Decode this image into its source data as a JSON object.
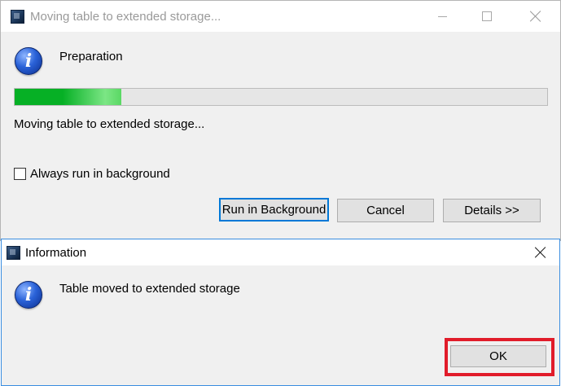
{
  "progress_dialog": {
    "title": "Moving table to extended storage...",
    "heading": "Preparation",
    "progress_fraction": 0.2,
    "status_text": "Moving table to extended storage...",
    "checkbox_label": "Always run in background",
    "checkbox_checked": false,
    "buttons": {
      "run_in_background": "Run in Background",
      "cancel": "Cancel",
      "details": "Details >>"
    }
  },
  "info_dialog": {
    "title": "Information",
    "message": "Table moved to extended storage",
    "ok_label": "OK"
  },
  "icons": {
    "app": "app-window-icon",
    "info": "information-icon",
    "minimize": "minimize-icon",
    "maximize": "maximize-icon",
    "close": "close-icon",
    "info_glyph": "i"
  },
  "colors": {
    "progress_green": "#06b025",
    "focus_blue": "#0078d7",
    "highlight_red": "#e11c2a"
  }
}
